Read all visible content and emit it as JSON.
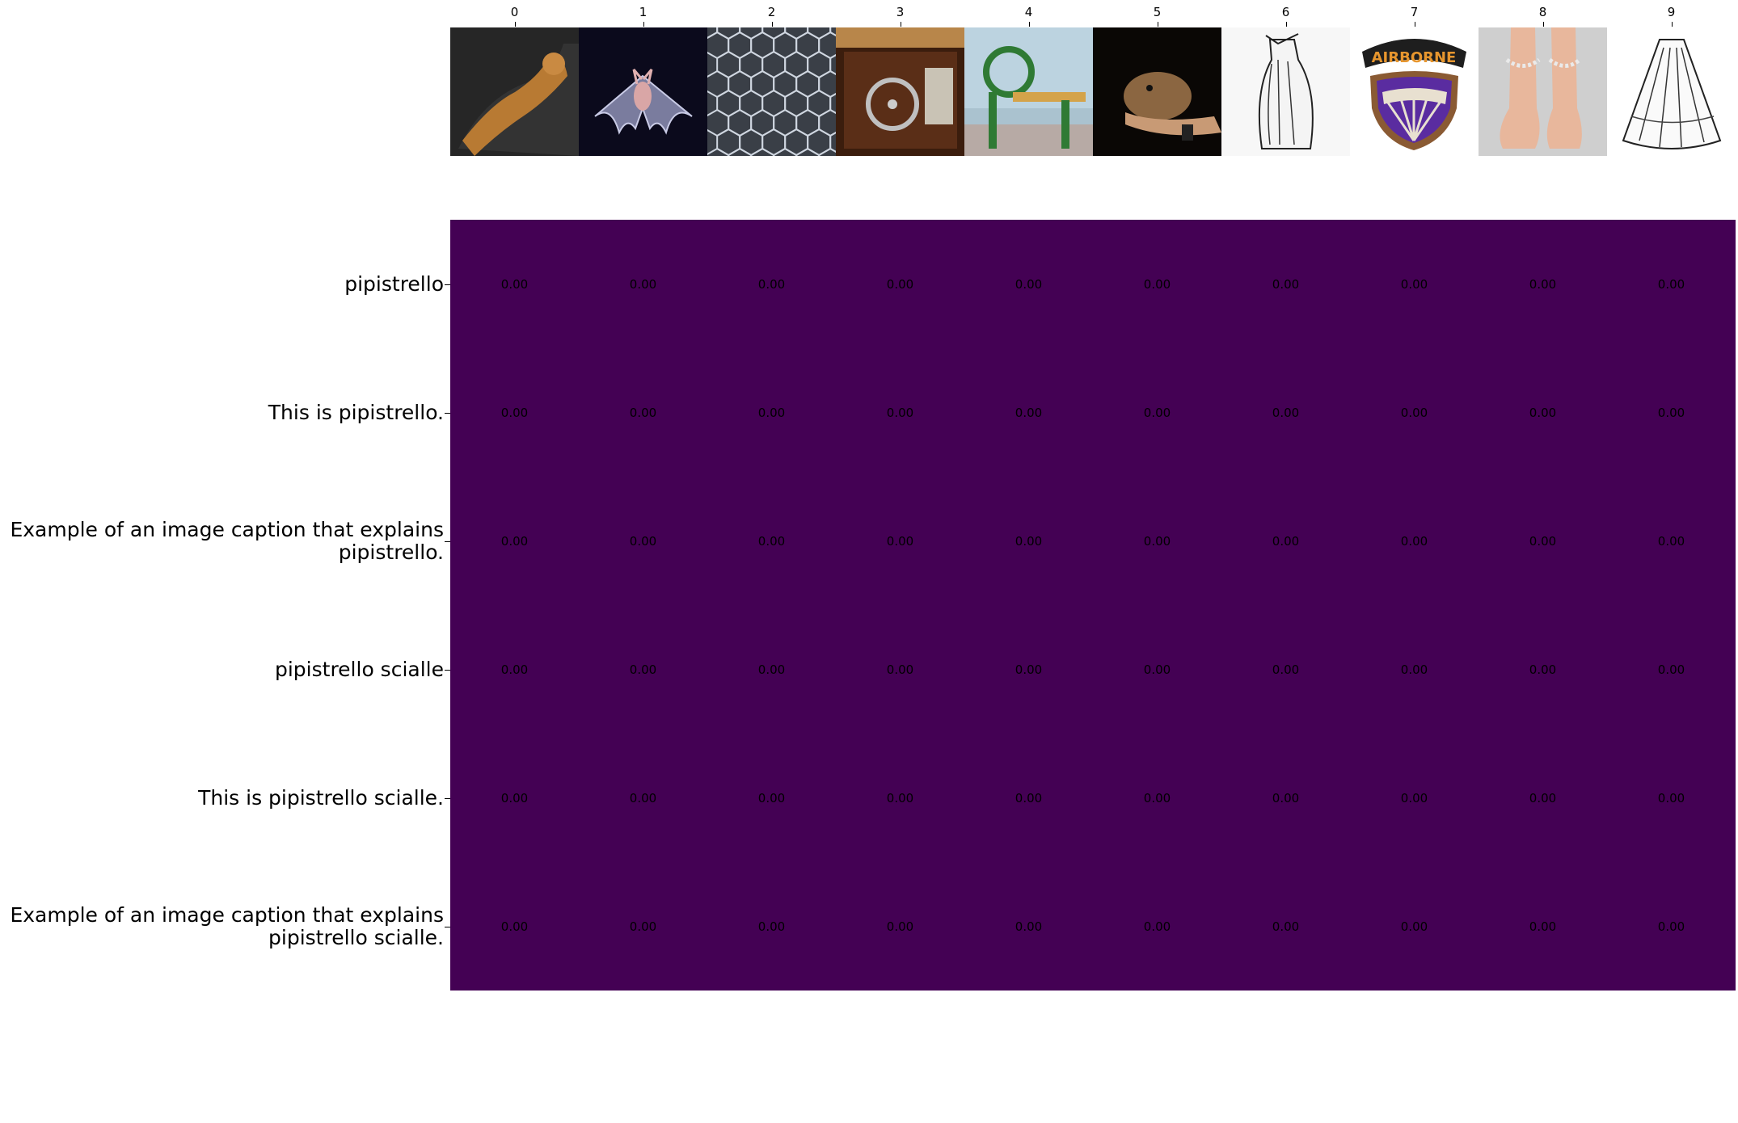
{
  "chart_data": {
    "type": "heatmap",
    "title": "",
    "xlabel": "",
    "ylabel": "",
    "columns": [
      "0",
      "1",
      "2",
      "3",
      "4",
      "5",
      "6",
      "7",
      "8",
      "9"
    ],
    "column_images": [
      "mummy",
      "bat",
      "chicken-wire-mesh",
      "loom-machine",
      "printing-press",
      "bat-on-hand",
      "drawn-cloak",
      "airborne-patch",
      "ankle-bracelets-feet",
      "drawn-cape"
    ],
    "column_image_text": [
      "",
      "",
      "",
      "",
      "",
      "",
      "",
      "AIRBORNE",
      "",
      ""
    ],
    "rows": [
      "pipistrello",
      "This is pipistrello.",
      "Example of an image caption that explains\npipistrello.",
      "pipistrello scialle",
      "This is pipistrello scialle.",
      "Example of an image caption that explains\npipistrello scialle."
    ],
    "values": [
      [
        0.0,
        0.0,
        0.0,
        0.0,
        0.0,
        0.0,
        0.0,
        0.0,
        0.0,
        0.0
      ],
      [
        0.0,
        0.0,
        0.0,
        0.0,
        0.0,
        0.0,
        0.0,
        0.0,
        0.0,
        0.0
      ],
      [
        0.0,
        0.0,
        0.0,
        0.0,
        0.0,
        0.0,
        0.0,
        0.0,
        0.0,
        0.0
      ],
      [
        0.0,
        0.0,
        0.0,
        0.0,
        0.0,
        0.0,
        0.0,
        0.0,
        0.0,
        0.0
      ],
      [
        0.0,
        0.0,
        0.0,
        0.0,
        0.0,
        0.0,
        0.0,
        0.0,
        0.0,
        0.0
      ],
      [
        0.0,
        0.0,
        0.0,
        0.0,
        0.0,
        0.0,
        0.0,
        0.0,
        0.0,
        0.0
      ]
    ],
    "cell_format": "0.00",
    "colormap": "viridis",
    "fill_color": "#440154"
  }
}
